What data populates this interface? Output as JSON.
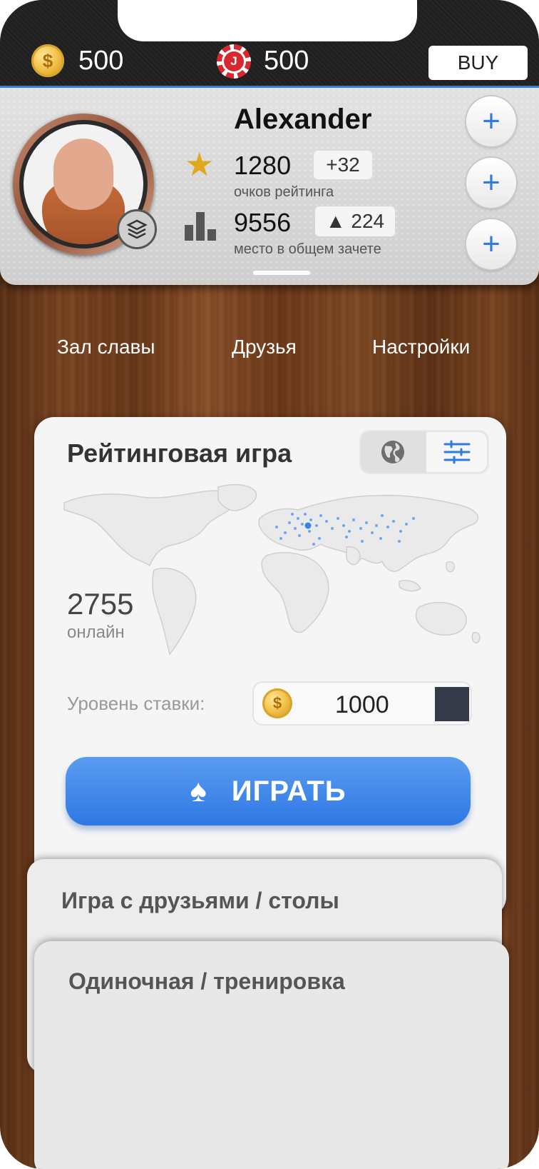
{
  "top_bar": {
    "coins": "500",
    "chips": "500",
    "chip_letter": "J",
    "coin_symbol": "$",
    "buy_label": "BUY"
  },
  "profile": {
    "name": "Alexander",
    "rating": "1280",
    "rating_delta": "+32",
    "rating_label": "очков рейтинга",
    "place": "9556",
    "place_delta": "▲ 224",
    "place_label": "место в общем зачете",
    "plus_label": "+"
  },
  "nav": {
    "items": [
      "Зал славы",
      "Друзья",
      "Настройки"
    ]
  },
  "ranked": {
    "title": "Рейтинговая игра",
    "online_count": "2755",
    "online_label": "онлайн",
    "stake_label": "Уровень ставки:",
    "stake_value": "1000",
    "play_label": "ИГРАТЬ"
  },
  "cards": {
    "friends_title": "Игра с друзьями / столы",
    "single_title": "Одиночная / тренировка"
  },
  "colors": {
    "accent_blue": "#2f78e4",
    "star_gold": "#e0a81f",
    "chip_red": "#d7282f"
  },
  "icons": [
    "coin-icon",
    "poker-chip-icon",
    "star-icon",
    "bar-chart-icon",
    "plus-icon",
    "globe-icon",
    "filter-icon",
    "spade-icon",
    "level-badge-icon"
  ]
}
